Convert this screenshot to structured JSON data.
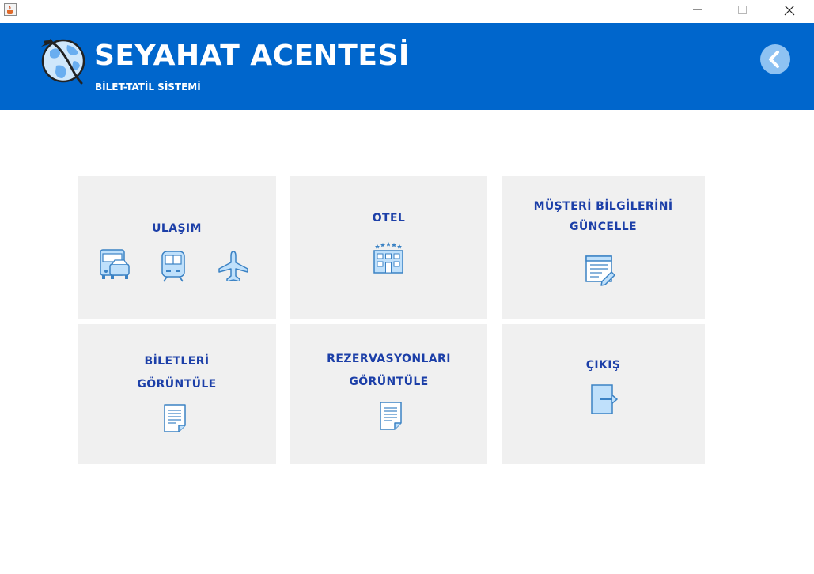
{
  "window": {
    "icon": "java-cup-icon",
    "controls": [
      "minimize-icon",
      "maximize-icon",
      "close-icon"
    ]
  },
  "header": {
    "title": "SEYAHAT ACENTESİ",
    "subtitle": "BİLET-TATİL SİSTEMİ",
    "logo_icon": "globe-plane-icon",
    "back_icon": "chevron-left-icon",
    "background_color": "#0066cc"
  },
  "tiles": {
    "ulasim": {
      "label": "ULAŞIM",
      "icons": [
        "bus-car-icon",
        "train-icon",
        "airplane-icon"
      ]
    },
    "otel": {
      "label": "OTEL",
      "icons": [
        "hotel-icon"
      ]
    },
    "musteri": {
      "label_line1": "MÜŞTERİ BİLGİLERİNİ",
      "label_line2": "GÜNCELLE",
      "icons": [
        "edit-document-icon"
      ]
    },
    "biletler": {
      "label_line1": "BİLETLERİ",
      "label_line2": "GÖRÜNTÜLE",
      "icons": [
        "document-icon"
      ]
    },
    "rezervasyonlar": {
      "label_line1": "REZERVASYONLARI",
      "label_line2": "GÖRÜNTÜLE",
      "icons": [
        "document-icon"
      ]
    },
    "cikis": {
      "label": "ÇIKIŞ",
      "icons": [
        "exit-icon"
      ]
    }
  },
  "colors": {
    "tile_background": "#f0f0f0",
    "tile_text": "#1c3fa8",
    "icon_fill": "#bfe0fb",
    "icon_stroke": "#3b82c4"
  }
}
